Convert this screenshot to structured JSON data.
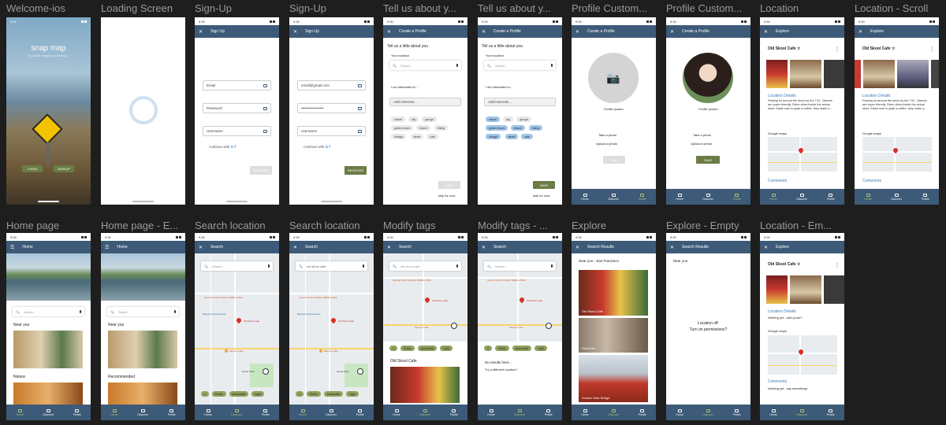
{
  "colors": {
    "appbar": "#3d5a78",
    "green": "#6b7c45",
    "chip_selected": "#9ec5e6",
    "background": "#1e1e1e"
  },
  "time": "9:30",
  "labels": {
    "f1": "Welcome-ios",
    "f2": "Loading Screen",
    "f3": "Sign-Up",
    "f4": "Sign-Up",
    "f5": "Tell us about y...",
    "f6": "Tell us about y...",
    "f7": "Profile Custom...",
    "f8": "Profile Custom...",
    "f9": "Location",
    "f10": "Location - Scroll",
    "f11": "Home page",
    "f12": "Home page - E...",
    "f13": "Search location",
    "f14": "Search location",
    "f15": "Modify tags",
    "f16": "Modify tags - ...",
    "f17": "Explore",
    "f18": "Explore - Empty",
    "f19": "Location - Em..."
  },
  "welcome": {
    "title": "snap map",
    "subtitle": "by mobile mapping for thinking...",
    "login": "LOGIN",
    "signup": "SIGNUP"
  },
  "signup": {
    "appbar": "Sign Up",
    "email_ph": "Email",
    "password_ph": "Password",
    "username_ph": "Username",
    "email_val": "email@gmail.com",
    "password_val": "••••••••••••••••••",
    "username_val": "username",
    "continue": "continue with",
    "register": "REGISTER"
  },
  "profile": {
    "appbar": "Create a Profile",
    "heading": "Tell us a little about you",
    "location_label": "Your location",
    "search": "Search",
    "interested": "I am interested in...",
    "add_interests": "Add interests...",
    "chips": [
      "nature",
      "city",
      "grunge",
      "golden hours",
      "beach",
      "hiking",
      "vintage",
      "street",
      "cafe"
    ],
    "save": "SAVE",
    "skip": "skip for now",
    "picture": "Profile picture",
    "take_photo": "Take a photo",
    "upload_photo": "Upload a photo"
  },
  "location": {
    "appbar": "Explore",
    "name": "Old Skool Cafe",
    "details": "Location Details",
    "desc": "Parking lot around the block by the 7/11. Owners are super friendly. Retro vibes inside the actual store. Make sure to grab a coffee, they make a...",
    "maps": "Google maps",
    "comments": "Comments",
    "empty_details": "Nothing yet...add yours?",
    "empty_comments": "Nothing yet...say something!"
  },
  "home": {
    "appbar": "Home",
    "search": "Search",
    "near": "Near you",
    "nature": "Nature",
    "recommended": "Recommended"
  },
  "searchscr": {
    "appbar": "Search",
    "search": "Search",
    "query": "old skool cafe",
    "tags": [
      "Public",
      "Accessible",
      "Light"
    ],
    "map_labels": [
      "Avenue North Chicken Waffles & Bar",
      "Bayview Opera House",
      "Old Skool Cafe",
      "Mama's Cafe",
      "Home Point"
    ],
    "result_title": "Old Skool Cafe",
    "no_results": "No results here...",
    "try_diff": "Try a different location?"
  },
  "explore": {
    "appbar": "Search Results",
    "near_sf": "Near you - San Francisco",
    "near": "Near you",
    "cards": [
      "Old Skool Cafe",
      "Street Art",
      "Golden Gate Bridge"
    ],
    "loc_off": "Location off.",
    "permissions": "Turn on permissions?"
  },
  "nav": {
    "home": "Home",
    "discover": "Discover",
    "profile": "Profile"
  }
}
